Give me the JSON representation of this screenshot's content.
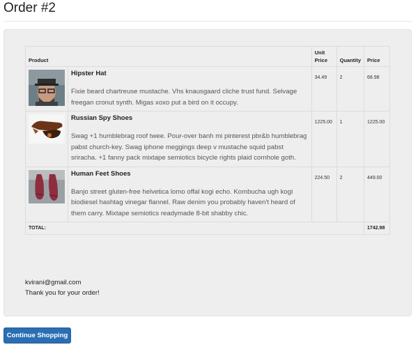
{
  "page": {
    "title": "Order #2"
  },
  "table": {
    "headers": {
      "product": "Product",
      "unit_price": "Unit Price",
      "quantity": "Quantity",
      "price": "Price"
    },
    "rows": [
      {
        "name": "Hipster Hat",
        "description": "Fixie beard chartreuse mustache. Vhs knausgaard cliche trust fund. Selvage freegan cronut synth. Migas xoxo put a bird on it occupy.",
        "unit_price": "34.49",
        "quantity": "2",
        "price": "68.98",
        "image": "hipster-hat-photo"
      },
      {
        "name": "Russian Spy Shoes",
        "description": "Swag +1 humblebrag roof twee. Pour-over banh mi pinterest pbr&b humblebrag pabst church-key. Swag iphone meggings deep v mustache squid pabst sriracha. +1 fanny pack mixtape semiotics bicycle rights plaid cornhole goth.",
        "unit_price": "1225.00",
        "quantity": "1",
        "price": "1225.00",
        "image": "spy-shoes-photo"
      },
      {
        "name": "Human Feet Shoes",
        "description": "Banjo street gluten-free helvetica lomo offal kogi echo. Kombucha ugh kogi biodiesel hashtag vinegar flannel. Raw denim you probably haven't heard of them carry. Mixtape semiotics readymade 8-bit shabby chic.",
        "unit_price": "224.50",
        "quantity": "2",
        "price": "449.00",
        "image": "feet-shoes-photo"
      }
    ],
    "total_label": "TOTAL:",
    "total_value": "1742.98"
  },
  "customer": {
    "email": "kvirani@gmail.com",
    "thanks": "Thank you for your order!"
  },
  "actions": {
    "continue_label": "Continue Shopping"
  },
  "colors": {
    "button": "#2a6eb3",
    "well": "#eeeeee"
  }
}
